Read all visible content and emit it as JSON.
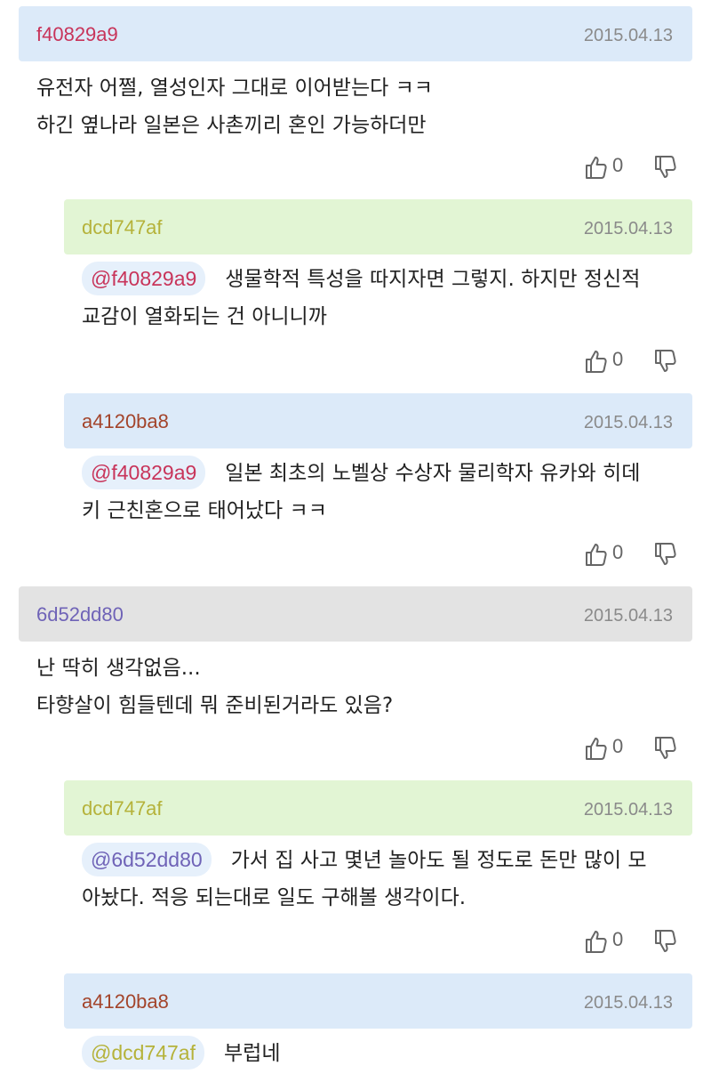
{
  "comments": [
    {
      "author": "f40829a9",
      "date": "2015.04.13",
      "line1": "유전자 어쩔, 열성인자 그대로 이어받는다 ㅋㅋ",
      "line2": "하긴 옆나라 일본은 사촌끼리 혼인 가능하더만",
      "votes": "0"
    },
    {
      "author": "dcd747af",
      "date": "2015.04.13",
      "mention": "@f40829a9",
      "line1": "생물학적 특성을 따지자면 그렇지. 하지만 정신적",
      "line2": "교감이 열화되는 건 아니니까",
      "votes": "0"
    },
    {
      "author": "a4120ba8",
      "date": "2015.04.13",
      "mention": "@f40829a9",
      "line1": "일본 최초의 노벨상 수상자 물리학자 유카와 히데",
      "line2": "키 근친혼으로 태어났다 ㅋㅋ",
      "votes": "0"
    },
    {
      "author": "6d52dd80",
      "date": "2015.04.13",
      "line1": "난 딱히 생각없음...",
      "line2": "타향살이 힘들텐데 뭐 준비된거라도 있음?",
      "votes": "0"
    },
    {
      "author": "dcd747af",
      "date": "2015.04.13",
      "mention": "@6d52dd80",
      "line1": "가서 집 사고 몇년 놀아도 될 정도로 돈만 많이 모",
      "line2": "아놨다. 적응 되는대로 일도 구해볼 생각이다.",
      "votes": "0"
    },
    {
      "author": "a4120ba8",
      "date": "2015.04.13",
      "mention": "@dcd747af",
      "line1": "부럽네"
    }
  ]
}
